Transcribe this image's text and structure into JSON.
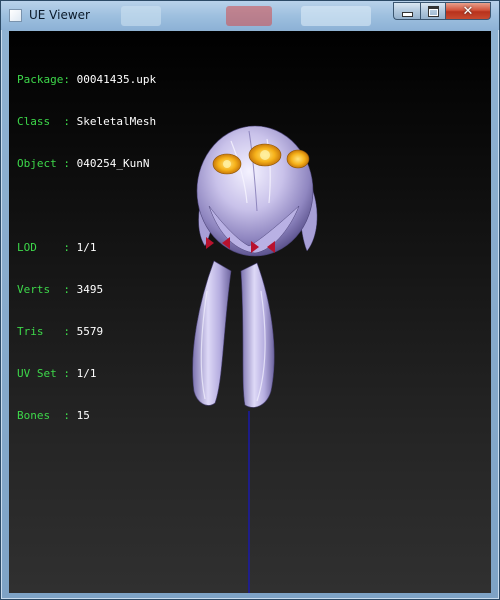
{
  "window": {
    "title": "UE Viewer",
    "minimize_icon": "minimize-icon",
    "maximize_icon": "maximize-icon",
    "close_icon": "close-icon"
  },
  "info": {
    "package": {
      "key": "Package:",
      "value": "00041435.upk"
    },
    "class": {
      "key": "Class  :",
      "value": "SkeletalMesh"
    },
    "object": {
      "key": "Object :",
      "value": "040254_KunN"
    },
    "lod": {
      "key": "LOD    :",
      "value": "1/1"
    },
    "verts": {
      "key": "Verts  :",
      "value": "3495"
    },
    "tris": {
      "key": "Tris   :",
      "value": "5579"
    },
    "uvset": {
      "key": "UV Set :",
      "value": "1/1"
    },
    "bones": {
      "key": "Bones  :",
      "value": "15"
    }
  },
  "colors": {
    "label_green": "#3dd84a",
    "value_white": "#ffffff",
    "bone_line": "#1a1aa8",
    "hair": "#cfc9ee",
    "ornament": "#f2b21c"
  }
}
